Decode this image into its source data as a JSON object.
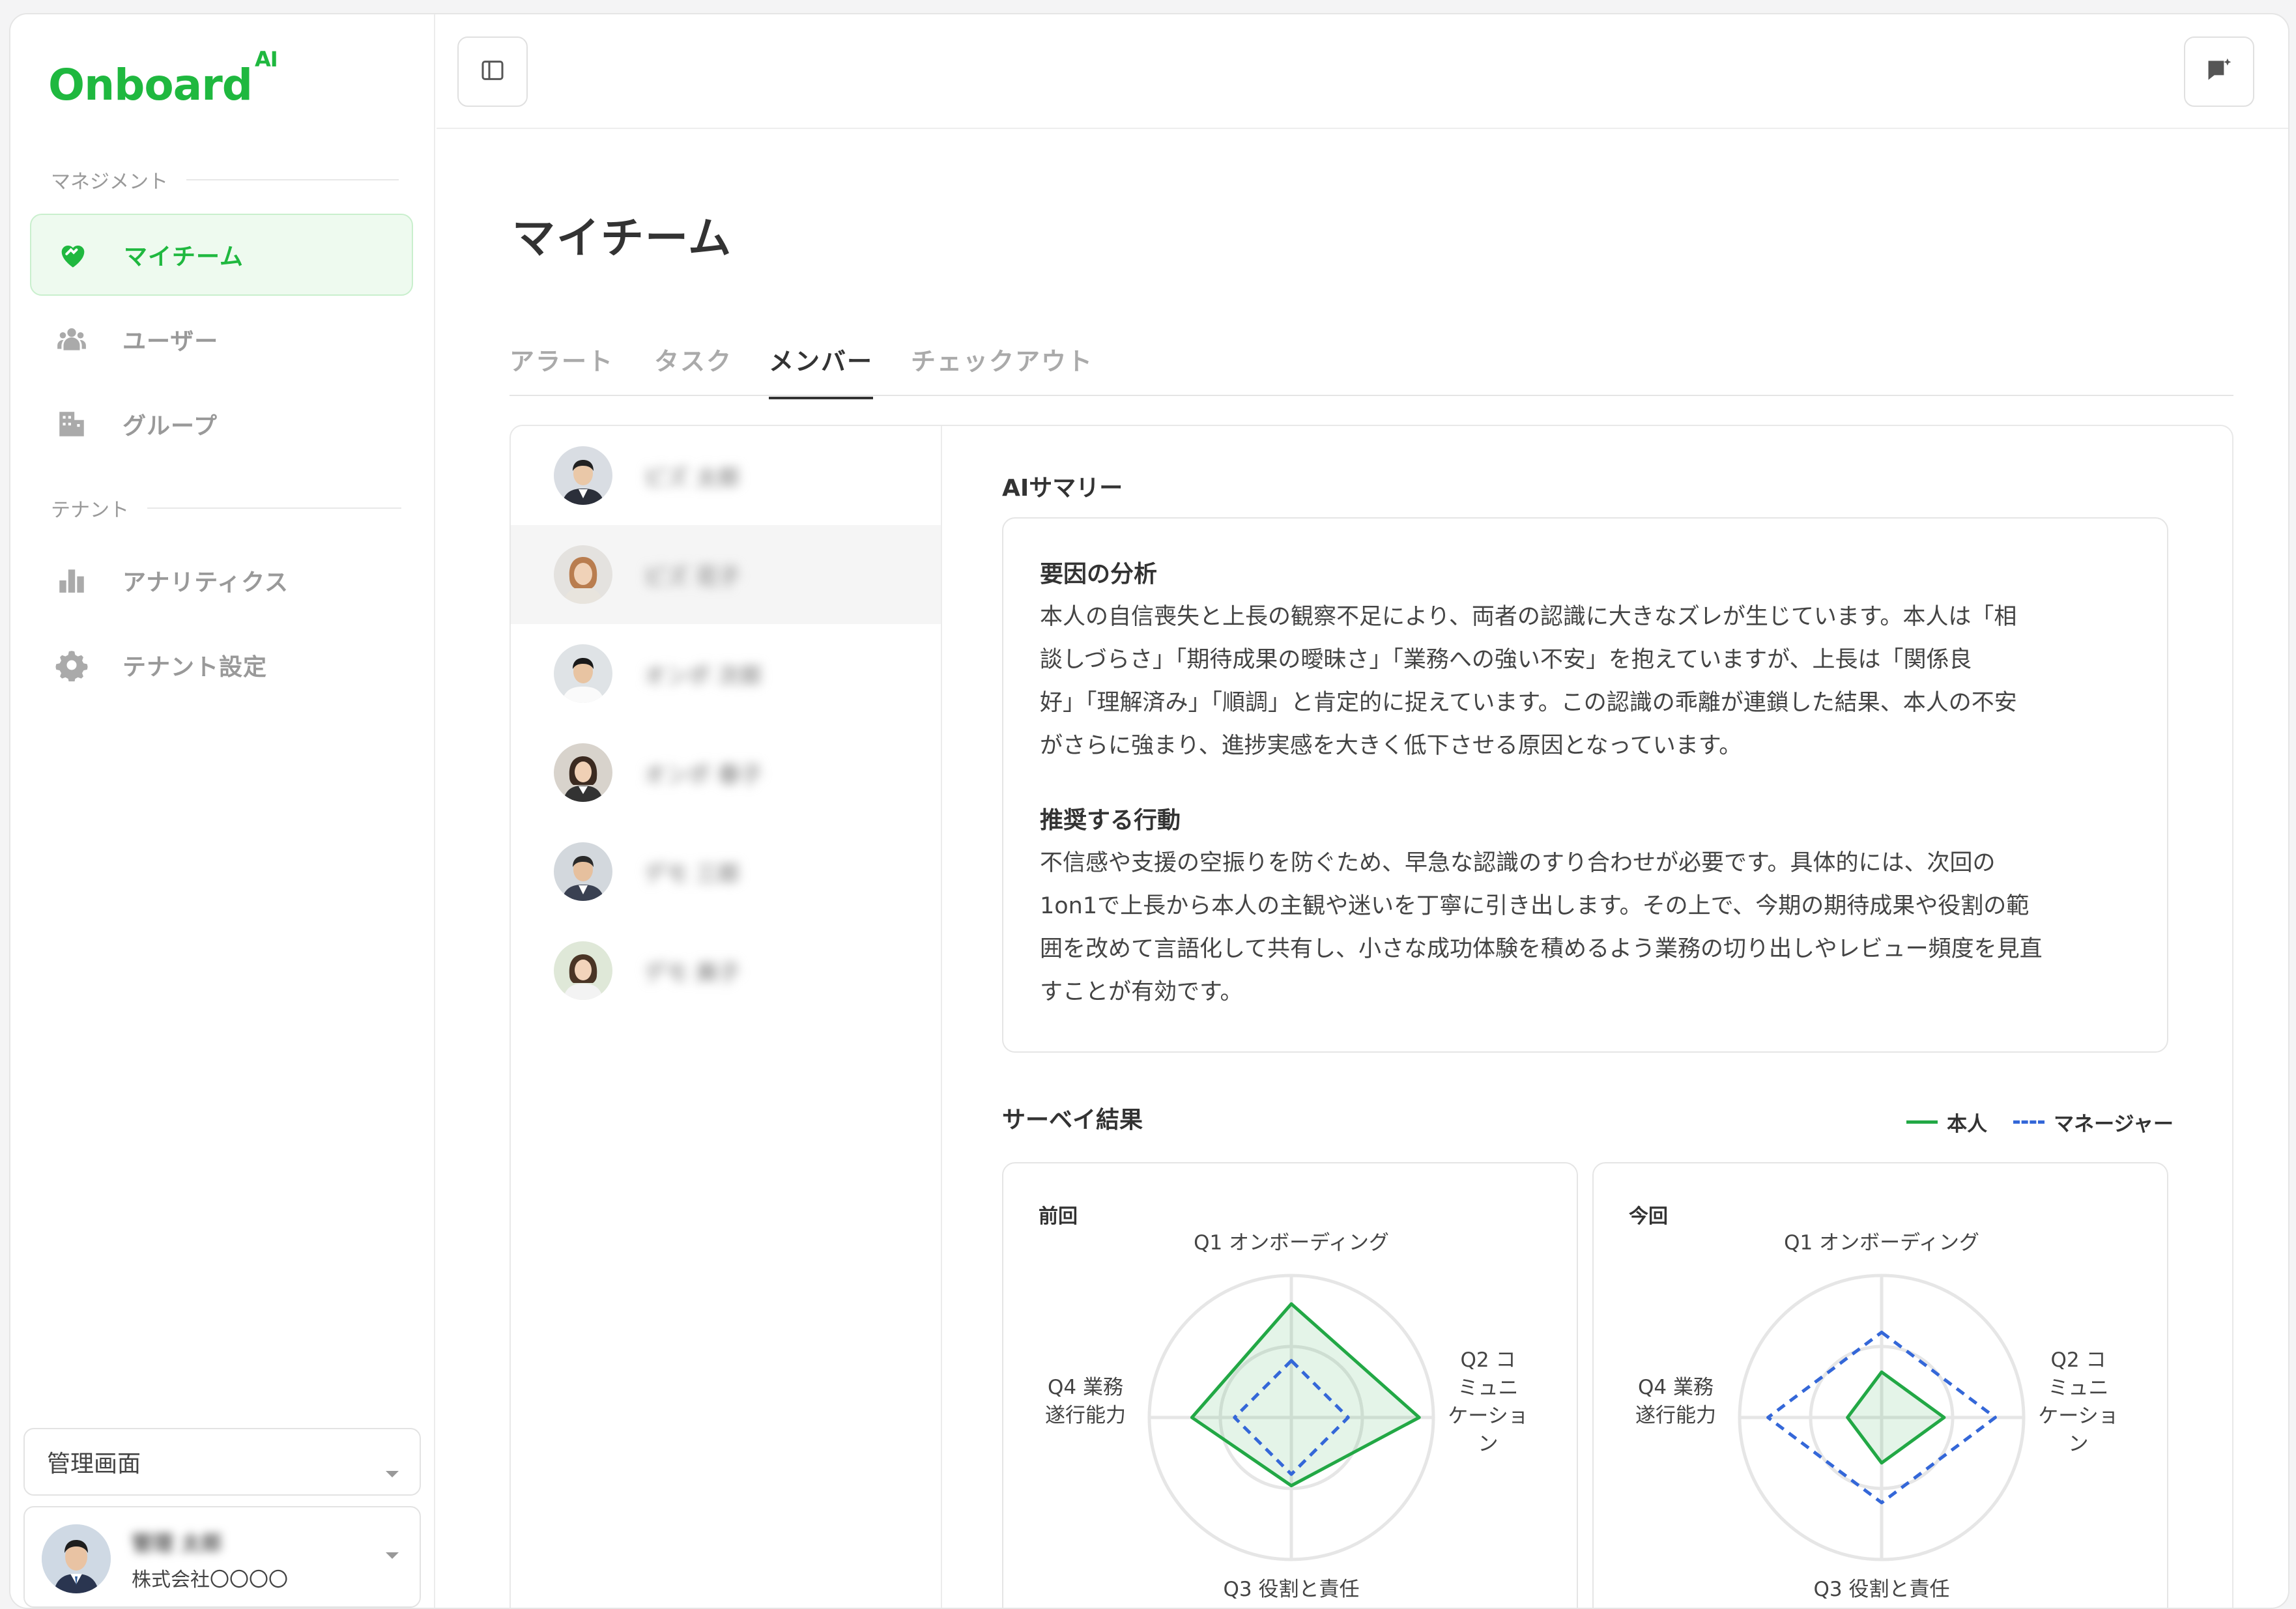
{
  "brand": {
    "name": "Onboard",
    "sup": "AI",
    "color": "#1fb83f"
  },
  "sidebar": {
    "section_management": "マネジメント",
    "section_tenant": "テナント",
    "items": [
      {
        "label": "マイチーム",
        "icon": "heart-handshake-icon",
        "active": true
      },
      {
        "label": "ユーザー",
        "icon": "users-icon"
      },
      {
        "label": "グループ",
        "icon": "building-icon"
      },
      {
        "label": "アナリティクス",
        "icon": "bar-chart-icon"
      },
      {
        "label": "テナント設定",
        "icon": "gear-icon"
      }
    ],
    "admin_select": "管理画面",
    "user": {
      "name": "管理 太郎",
      "company": "株式会社〇〇〇〇"
    }
  },
  "topbar": {
    "left_icon": "sidebar-toggle-icon",
    "right_icon": "chat-sparkle-icon"
  },
  "page": {
    "title": "マイチーム",
    "tabs": [
      "アラート",
      "タスク",
      "メンバー",
      "チェックアウト"
    ],
    "active_tab": "メンバー"
  },
  "members": [
    {
      "name": "ビズ 太郎"
    },
    {
      "name": "ビズ 花子",
      "selected": true
    },
    {
      "name": "オンボ 次郎"
    },
    {
      "name": "オンボ 春子"
    },
    {
      "name": "デモ 三郎"
    },
    {
      "name": "デモ 美子"
    }
  ],
  "summary": {
    "title": "AIサマリー",
    "factor_title": "要因の分析",
    "factor_lines": [
      "本人の自信喪失と上長の観察不足により、両者の認識に大きなズレが生じています。本人は「相",
      "談しづらさ」「期待成果の曖昧さ」「業務への強い不安」を抱えていますが、上長は「関係良",
      "好」「理解済み」「順調」と肯定的に捉えています。この認識の乖離が連鎖した結果、本人の不安",
      "がさらに強まり、進捗実感を大きく低下させる原因となっています。"
    ],
    "action_title": "推奨する行動",
    "action_lines": [
      "不信感や支援の空振りを防ぐため、早急な認識のすり合わせが必要です。具体的には、次回の",
      "1on1で上長から本人の主観や迷いを丁寧に引き出します。その上で、今期の期待成果や役割の範",
      "囲を改めて言語化して共有し、小さな成功体験を積めるよう業務の切り出しやレビュー頻度を見直",
      "すことが有効です。"
    ]
  },
  "survey": {
    "title": "サーベイ結果",
    "legend": [
      {
        "name": "本人",
        "color": "#22a845",
        "style": "solid"
      },
      {
        "name": "マネージャー",
        "color": "#3467d8",
        "style": "dashed"
      }
    ],
    "axes": [
      "Q1 オンボーディング",
      "Q2 コミュニケーション",
      "Q3 役割と責任",
      "Q4 業務遂行能力"
    ],
    "axis_label_lines": {
      "q1": [
        "Q1 オンボーディング"
      ],
      "q2": [
        "Q2 コ",
        "ミュニ",
        "ケーショ",
        "ン"
      ],
      "q3": [
        "Q3 役割と責任"
      ],
      "q4": [
        "Q4 業務",
        "遂行能力"
      ]
    }
  },
  "chart_data": [
    {
      "type": "radar",
      "title": "前回",
      "axes": [
        "Q1 オンボーディング",
        "Q2 コミュニケーション",
        "Q3 役割と責任",
        "Q4 業務遂行能力"
      ],
      "range": [
        0,
        5
      ],
      "series": [
        {
          "name": "本人",
          "values": [
            4.0,
            4.5,
            2.4,
            3.5
          ]
        },
        {
          "name": "マネージャー",
          "values": [
            2.0,
            2.0,
            2.0,
            2.0
          ]
        }
      ]
    },
    {
      "type": "radar",
      "title": "今回",
      "axes": [
        "Q1 オンボーディング",
        "Q2 コミュニケーション",
        "Q3 役割と責任",
        "Q4 業務遂行能力"
      ],
      "range": [
        0,
        5
      ],
      "series": [
        {
          "name": "本人",
          "values": [
            1.6,
            2.2,
            1.6,
            1.2
          ]
        },
        {
          "name": "マネージャー",
          "values": [
            3.0,
            4.0,
            3.0,
            4.0
          ]
        }
      ]
    }
  ]
}
